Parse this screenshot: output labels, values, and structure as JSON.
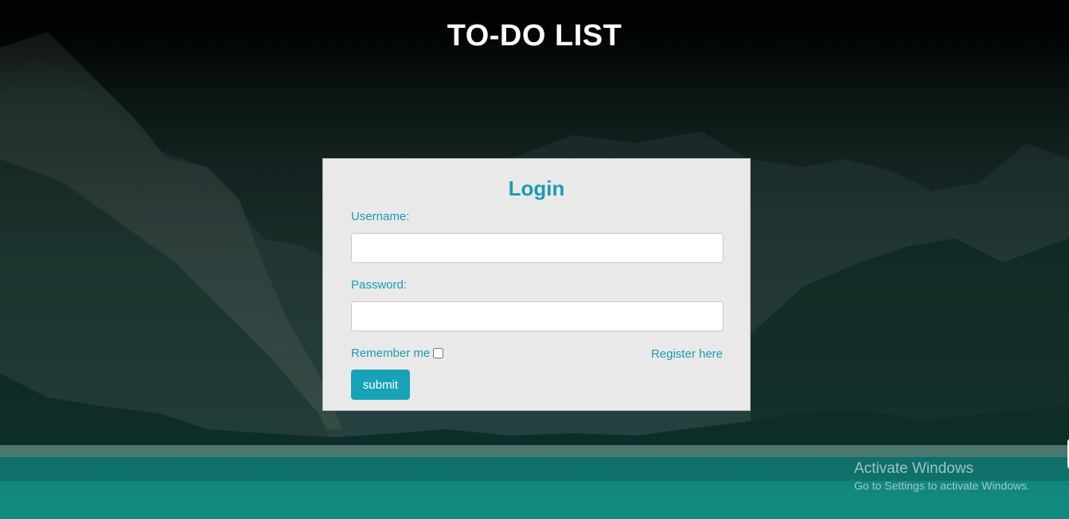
{
  "header": {
    "title": "TO-DO LIST"
  },
  "login": {
    "heading": "Login",
    "username_label": "Username:",
    "username_value": "",
    "password_label": "Password:",
    "password_value": "",
    "remember_label": "Remember me",
    "remember_checked": false,
    "register_link": "Register here",
    "submit_label": "submit"
  },
  "watermark": {
    "title": "Activate Windows",
    "subtitle": "Go to Settings to activate Windows."
  },
  "colors": {
    "accent": "#1a9bb5",
    "button": "#17a2b8",
    "card_bg": "#e9e9e9"
  }
}
